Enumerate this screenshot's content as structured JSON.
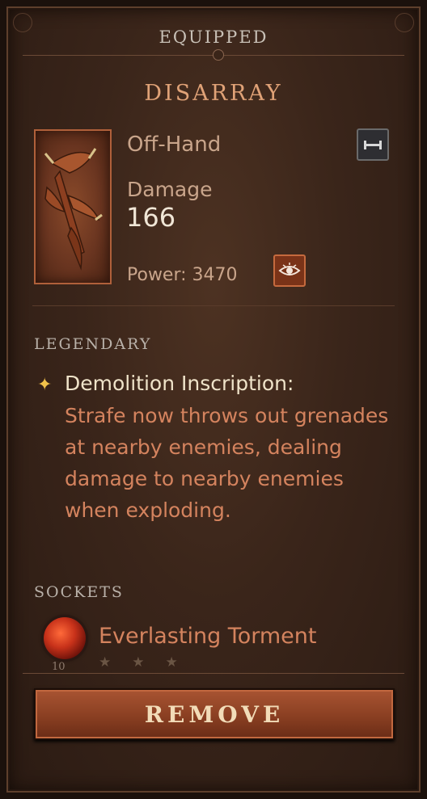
{
  "header": {
    "title": "EQUIPPED"
  },
  "item": {
    "name": "DISARRAY",
    "slot": "Off-Hand",
    "damage_label": "Damage",
    "damage_value": "166",
    "power_text": "Power: 3470"
  },
  "legendary": {
    "section_label": "LEGENDARY",
    "title": "Demolition Inscription:",
    "description": "Strafe now throws out grenades at nearby enemies, dealing damage to nearby enemies when exploding."
  },
  "sockets": {
    "section_label": "SOCKETS",
    "gem_name": "Everlasting Torment",
    "gem_level": "10",
    "gem_stars": "★★★"
  },
  "actions": {
    "remove_label": "REMOVE"
  },
  "icons": {
    "slot_icon": "equipment-slot-icon",
    "view_icon": "eye-icon",
    "legendary_icon": "star-icon",
    "gem_icon": "gem-icon"
  },
  "colors": {
    "item_name": "#e0a277",
    "legendary_text": "#d4835e",
    "legendary_star": "#f2c24a",
    "button": "#8a3f22"
  }
}
